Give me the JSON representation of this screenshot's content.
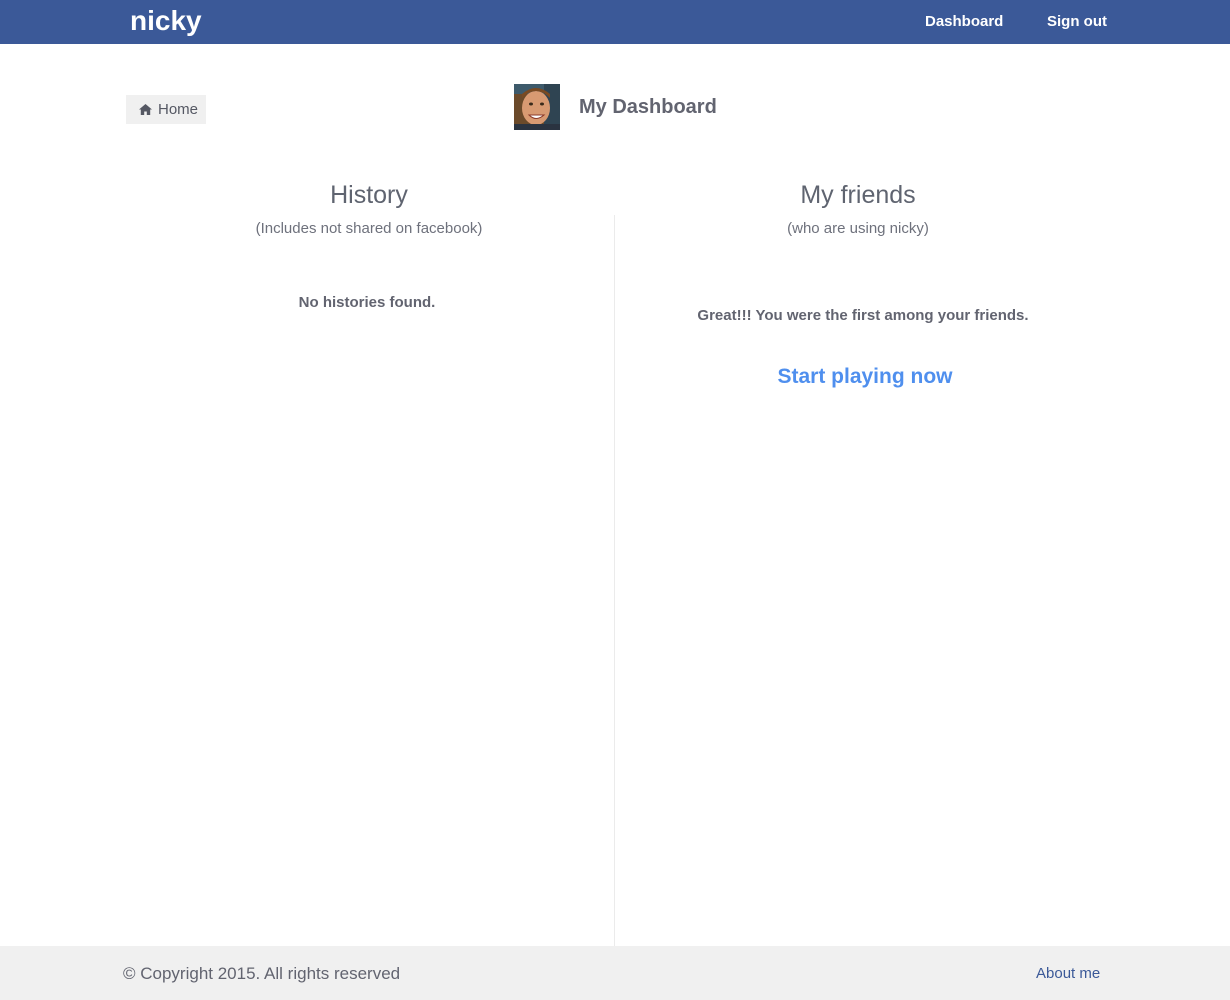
{
  "navbar": {
    "brand": "nicky",
    "links": {
      "dashboard": "Dashboard",
      "sign_out": "Sign out"
    },
    "background_color": "#3b5998"
  },
  "breadcrumb": {
    "home_label": "Home",
    "home_icon": "home-icon"
  },
  "header": {
    "title": "My Dashboard",
    "avatar": "user-avatar"
  },
  "history": {
    "heading": "History",
    "subheading": "(Includes not shared on facebook)",
    "empty_message": "No histories found."
  },
  "friends": {
    "heading": "My friends",
    "subheading": "(who are using nicky)",
    "empty_message": "Great!!! You were the first among your friends.",
    "cta_label": "Start playing now",
    "cta_color": "#4f8fee"
  },
  "footer": {
    "copyright": "© Copyright 2015. All rights reserved",
    "about_label": "About me"
  }
}
